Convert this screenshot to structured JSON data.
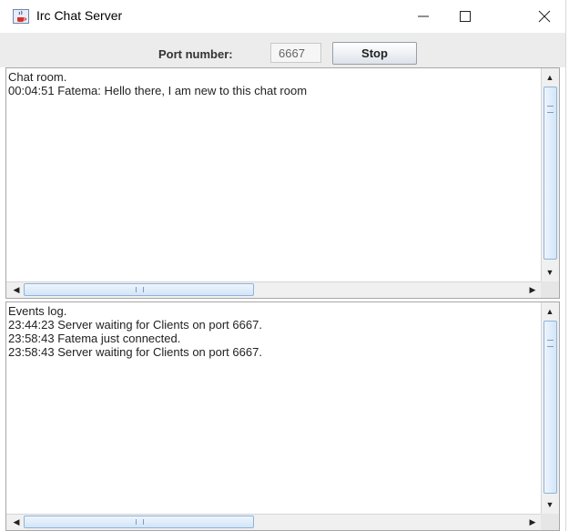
{
  "window": {
    "title": "Irc Chat Server",
    "icon": "java-cup-icon",
    "controls": [
      "minimize-icon",
      "maximize-icon",
      "close-icon"
    ]
  },
  "toolbar": {
    "port_label": "Port number:",
    "port_value": "6667",
    "stop_label": "Stop"
  },
  "chat_room": {
    "lines": [
      "Chat room.",
      "00:04:51 Fatema: Hello there, I am new to this chat room"
    ]
  },
  "events_log": {
    "lines": [
      "Events log.",
      "23:44:23 Server waiting for Clients on port 6667.",
      "23:58:43 Fatema just connected.",
      "23:58:43 Server waiting for Clients on port 6667."
    ]
  },
  "colors": {
    "toolbar_bg": "#ececec",
    "scroll_thumb": "#d3e5f8",
    "accent_border": "#8fb3d9"
  }
}
